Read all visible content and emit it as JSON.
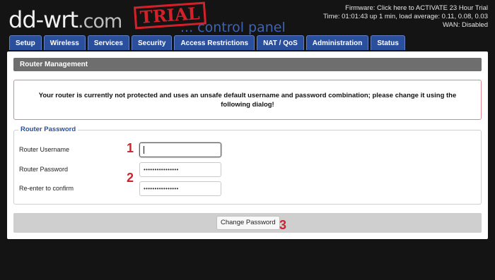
{
  "header": {
    "logo_main": "dd-wrt",
    "logo_tld": ".com",
    "logo_stamp": "TRIAL",
    "logo_sub": "... control panel",
    "firmware": "Firmware: Click here to ACTIVATE 23 Hour Trial",
    "time": "Time: 01:01:43 up 1 min, load average: 0.11, 0.08, 0.03",
    "wan": "WAN: Disabled"
  },
  "tabs": [
    "Setup",
    "Wireless",
    "Services",
    "Security",
    "Access Restrictions",
    "NAT / QoS",
    "Administration",
    "Status"
  ],
  "page": {
    "section_title": "Router Management",
    "warning": "Your router is currently not protected and uses an unsafe default username and password combination; please change it using the following dialog!",
    "legend": "Router Password",
    "username_label": "Router Username",
    "username_value": "",
    "password_label": "Router Password",
    "password_value": "••••••••••••••••",
    "confirm_label": "Re-enter to confirm",
    "confirm_value": "••••••••••••••••",
    "change_button": "Change Password"
  },
  "markers": [
    "1",
    "2",
    "3"
  ],
  "colors": {
    "tab_bg": "#2a4f9c",
    "marker": "#d3212a",
    "section_title_bg": "#6e6e6e",
    "warning_border": "#e2858c"
  }
}
